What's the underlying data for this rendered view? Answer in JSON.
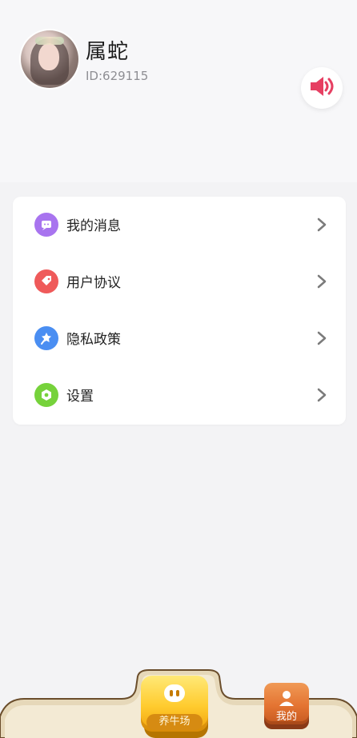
{
  "profile": {
    "name": "属蛇",
    "id_text": "ID:629115"
  },
  "menu": {
    "items": [
      {
        "label": "我的消息",
        "icon": "message-icon",
        "color": "#a874ef"
      },
      {
        "label": "用户协议",
        "icon": "tag-icon",
        "color": "#ef5a5a"
      },
      {
        "label": "隐私政策",
        "icon": "star-pin-icon",
        "color": "#4a8ef2"
      },
      {
        "label": "设置",
        "icon": "gear-icon",
        "color": "#76d23b"
      }
    ]
  },
  "nav": {
    "home_label": "养牛场",
    "mine_label": "我的"
  },
  "colors": {
    "page_bg": "#f3f3f5",
    "card_bg": "#ffffff",
    "speaker": "#e63f62"
  }
}
